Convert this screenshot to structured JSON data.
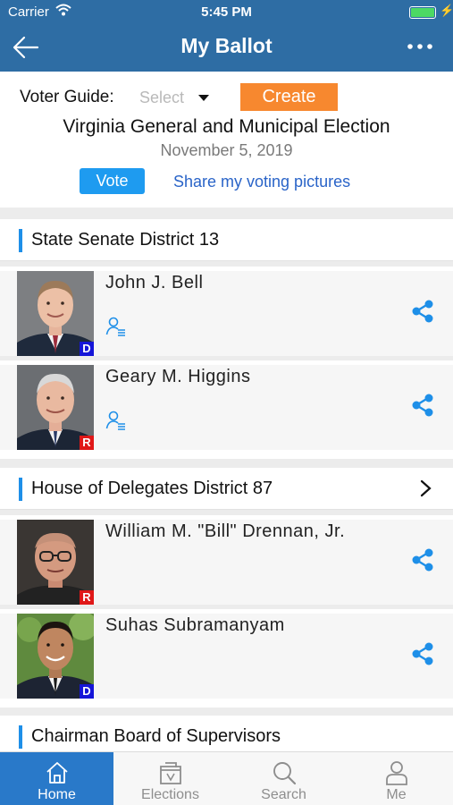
{
  "status": {
    "carrier": "Carrier",
    "time": "5:45 PM"
  },
  "nav": {
    "title": "My Ballot"
  },
  "guide": {
    "label": "Voter Guide:",
    "select_value": "Select",
    "create_label": "Create"
  },
  "election": {
    "title": "Virginia General and Municipal Election",
    "date": "November 5, 2019",
    "vote_label": "Vote",
    "share_label": "Share my voting pictures"
  },
  "sections": [
    {
      "title": "State Senate District 13",
      "candidates": [
        {
          "name": "John J. Bell",
          "party": "D"
        },
        {
          "name": "Geary M. Higgins",
          "party": "R"
        }
      ]
    },
    {
      "title": "House of Delegates District 87",
      "candidates": [
        {
          "name": "William M. \"Bill\" Drennan, Jr.",
          "party": "R"
        },
        {
          "name": "Suhas Subramanyam",
          "party": "D"
        }
      ]
    },
    {
      "title": "Chairman Board of Supervisors"
    }
  ],
  "tabs": [
    {
      "label": "Home"
    },
    {
      "label": "Elections"
    },
    {
      "label": "Search"
    },
    {
      "label": "Me"
    }
  ],
  "colors": {
    "header": "#2e6da4",
    "accent": "#1e8fe8",
    "create": "#f7882f",
    "democrat": "#1515d8",
    "republican": "#e01818",
    "tab_active": "#2979c9"
  },
  "icons": [
    "back-arrow-icon",
    "more-icon",
    "profile-list-icon",
    "share-icon",
    "chevron-right-icon",
    "home-icon",
    "ballot-box-icon",
    "search-icon",
    "person-icon"
  ]
}
